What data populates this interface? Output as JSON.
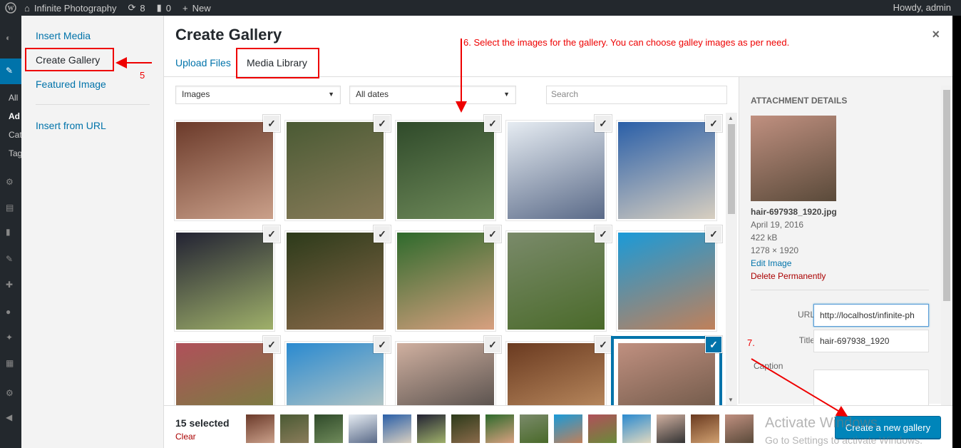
{
  "adminbar": {
    "site_name": "Infinite Photography",
    "updates_count": "8",
    "comments_count": "0",
    "new_label": "New",
    "howdy": "Howdy, admin"
  },
  "admin_menu_fragments": [
    "All",
    "Ad",
    "Cat",
    "Tag"
  ],
  "media_menu": {
    "items": [
      "Insert Media",
      "Create Gallery",
      "Featured Image",
      "Insert from URL"
    ],
    "active_index": 1
  },
  "frame": {
    "title": "Create Gallery",
    "close_symbol": "×",
    "tabs": [
      "Upload Files",
      "Media Library"
    ],
    "active_tab": 1
  },
  "toolbar": {
    "type_filter": "Images",
    "date_filter": "All dates",
    "search_placeholder": "Search"
  },
  "grid": {
    "tiles": [
      {
        "name": "portrait-red-hair",
        "colors": [
          "#6b3a2a",
          "#caa08a"
        ]
      },
      {
        "name": "elephants-river",
        "colors": [
          "#4a5a34",
          "#8a7c5a"
        ]
      },
      {
        "name": "buddha-statue",
        "colors": [
          "#2f4a2a",
          "#6f8a5a"
        ]
      },
      {
        "name": "snow-mountains",
        "colors": [
          "#e6ecf2",
          "#5a6a88"
        ]
      },
      {
        "name": "stupa-temple",
        "colors": [
          "#2a5fa8",
          "#d8cfc0"
        ]
      },
      {
        "name": "camera-lens",
        "colors": [
          "#223",
          "#9fb06a"
        ]
      },
      {
        "name": "two-girls-walking",
        "colors": [
          "#2c3a1a",
          "#8a6a4a"
        ]
      },
      {
        "name": "three-women-group",
        "colors": [
          "#2e6a2c",
          "#d8a080"
        ]
      },
      {
        "name": "green-hills-clouds",
        "colors": [
          "#7a8a6a",
          "#4a6a2a"
        ]
      },
      {
        "name": "woman-in-pool",
        "colors": [
          "#1a9ad8",
          "#c0805a"
        ]
      },
      {
        "name": "dancer-girls",
        "colors": [
          "#b0505a",
          "#6a8a3a"
        ]
      },
      {
        "name": "beach-sea",
        "colors": [
          "#2a8ad0",
          "#e0d8c0"
        ]
      },
      {
        "name": "woman-striped-top",
        "colors": [
          "#d0b0a0",
          "#333"
        ]
      },
      {
        "name": "woman-finger-lips",
        "colors": [
          "#6a3a20",
          "#d0a070"
        ]
      },
      {
        "name": "hair-portrait",
        "colors": [
          "#c09080",
          "#5a4a3a"
        ]
      }
    ],
    "focused_index": 14
  },
  "attachment": {
    "heading": "ATTACHMENT DETAILS",
    "filename": "hair-697938_1920.jpg",
    "date": "April 19, 2016",
    "size": "422 kB",
    "dimensions": "1278 × 1920",
    "edit_link": "Edit Image",
    "delete_link": "Delete Permanently",
    "url_label": "URL",
    "url_value": "http://localhost/infinite-ph",
    "title_label": "Title",
    "title_value": "hair-697938_1920",
    "caption_label": "Caption"
  },
  "bottom": {
    "selected_count": "15 selected",
    "clear_label": "Clear",
    "create_button": "Create a new gallery"
  },
  "watermark": {
    "line1": "Activate Windows",
    "line2": "Go to Settings to activate Windows."
  },
  "annotations": {
    "step5": "5",
    "step6": "6. Select the images for the gallery. You can choose galley images as per need.",
    "step7": "7."
  }
}
